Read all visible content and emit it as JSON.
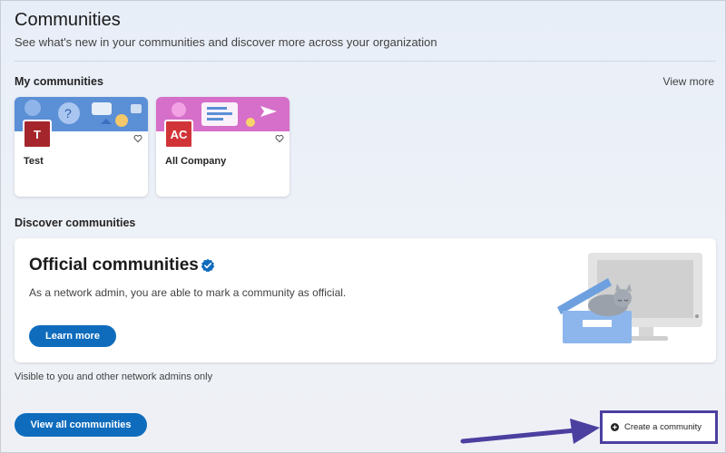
{
  "header": {
    "title": "Communities",
    "subtitle": "See what's new in your communities and discover more across your organization"
  },
  "my_communities": {
    "title": "My communities",
    "view_more_label": "View more",
    "cards": [
      {
        "initials": "T",
        "name": "Test",
        "color": "#a4262c"
      },
      {
        "initials": "AC",
        "name": "All Company",
        "color": "#d13438"
      }
    ]
  },
  "discover": {
    "title": "Discover communities",
    "official": {
      "title": "Official communities",
      "description": "As a network admin, you are able to mark a community as official.",
      "learn_more_label": "Learn more"
    },
    "visibility_note": "Visible to you and other network admins only",
    "view_all_label": "View all communities"
  },
  "actions": {
    "create_label": "Create a community"
  },
  "colors": {
    "accent": "#0f6cbd",
    "annotation": "#4b3fa0"
  }
}
